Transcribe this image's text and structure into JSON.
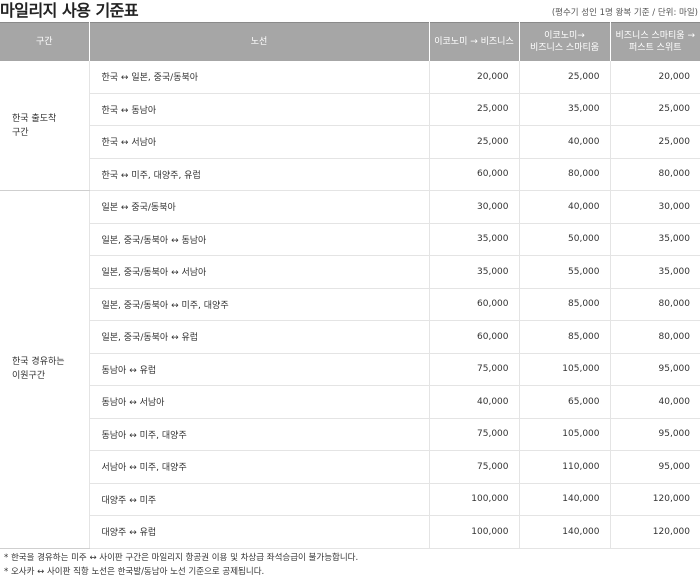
{
  "header": {
    "title": "마일리지 사용 기준표",
    "unit_note": "(평수기 성인 1명 왕복 기준 / 단위: 마일)"
  },
  "table": {
    "columns": {
      "section": "구간",
      "route": "노선",
      "col1": "이코노미 → 비즈니스",
      "col2_line1": "이코노미→",
      "col2_line2": "비즈니스 스마티움",
      "col3_line1": "비즈니스 스마티움 →",
      "col3_line2": "퍼스트 스위트"
    },
    "sections": [
      {
        "label_line1": "한국 출도착",
        "label_line2": "구간",
        "rows": [
          {
            "route": "한국 ↔ 일본, 중국/동북아",
            "v1": "20,000",
            "v2": "25,000",
            "v3": "20,000"
          },
          {
            "route": "한국 ↔ 동남아",
            "v1": "25,000",
            "v2": "35,000",
            "v3": "25,000"
          },
          {
            "route": "한국 ↔ 서남아",
            "v1": "25,000",
            "v2": "40,000",
            "v3": "25,000"
          },
          {
            "route": "한국 ↔ 미주, 대양주, 유럽",
            "v1": "60,000",
            "v2": "80,000",
            "v3": "80,000"
          }
        ]
      },
      {
        "label_line1": "한국 경유하는",
        "label_line2": "이원구간",
        "rows": [
          {
            "route": "일본 ↔ 중국/동북아",
            "v1": "30,000",
            "v2": "40,000",
            "v3": "30,000"
          },
          {
            "route": "일본, 중국/동북아 ↔ 동남아",
            "v1": "35,000",
            "v2": "50,000",
            "v3": "35,000"
          },
          {
            "route": "일본, 중국/동북아 ↔ 서남아",
            "v1": "35,000",
            "v2": "55,000",
            "v3": "35,000"
          },
          {
            "route": "일본, 중국/동북아 ↔ 미주, 대양주",
            "v1": "60,000",
            "v2": "85,000",
            "v3": "80,000"
          },
          {
            "route": "일본, 중국/동북아 ↔ 유럽",
            "v1": "60,000",
            "v2": "85,000",
            "v3": "80,000"
          },
          {
            "route": "동남아 ↔ 유럽",
            "v1": "75,000",
            "v2": "105,000",
            "v3": "95,000"
          },
          {
            "route": "동남아 ↔ 서남아",
            "v1": "40,000",
            "v2": "65,000",
            "v3": "40,000"
          },
          {
            "route": "동남아 ↔ 미주, 대양주",
            "v1": "75,000",
            "v2": "105,000",
            "v3": "95,000"
          },
          {
            "route": "서남아 ↔ 미주, 대양주",
            "v1": "75,000",
            "v2": "110,000",
            "v3": "95,000"
          },
          {
            "route": "대양주 ↔ 미주",
            "v1": "100,000",
            "v2": "140,000",
            "v3": "120,000"
          },
          {
            "route": "대양주 ↔ 유럽",
            "v1": "100,000",
            "v2": "140,000",
            "v3": "120,000"
          }
        ]
      }
    ]
  },
  "notes": [
    "* 한국을 경유하는 미주 ↔ 사이판 구간은 마일리지 항공권 이용 및 차상급 좌석승급이 불가능합니다.",
    "* 오사카 ↔ 사이판 직항 노선은 한국발/동남아 노선 기준으로 공제됩니다."
  ]
}
